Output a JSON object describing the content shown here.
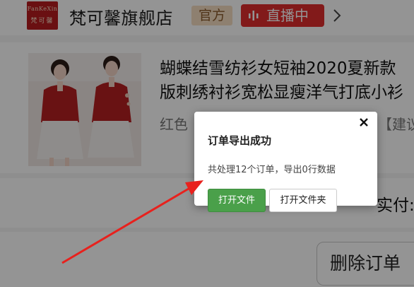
{
  "shop": {
    "logo_line1": "FanKeXin",
    "logo_line2": "梵可馨",
    "name": "梵可馨旗舰店",
    "official_badge": "官方",
    "live_badge": "直播中"
  },
  "order": {
    "title_line1": "蝴蝶结雪纺衫女短袖2020夏新款",
    "title_line2": "版刺绣衬衫宽松显瘦洋气打底小衫",
    "spec": "红色",
    "spec_right": "【建议",
    "paid_label": "实付:",
    "delete_button": "删除订单"
  },
  "dialog": {
    "title": "订单导出成功",
    "message": "共处理12个订单，导出0行数据",
    "open_file_button": "打开文件",
    "open_folder_button": "打开文件夹"
  },
  "colors": {
    "primary_green": "#4aa04a",
    "live_red": "#e02d2d",
    "arrow_red": "#e8211d",
    "official_bg": "#f4ddc2"
  },
  "icons": {
    "close": "close-icon",
    "live": "live-icon",
    "chevron": "chevron-right-icon",
    "arrow": "arrow-annotation"
  }
}
